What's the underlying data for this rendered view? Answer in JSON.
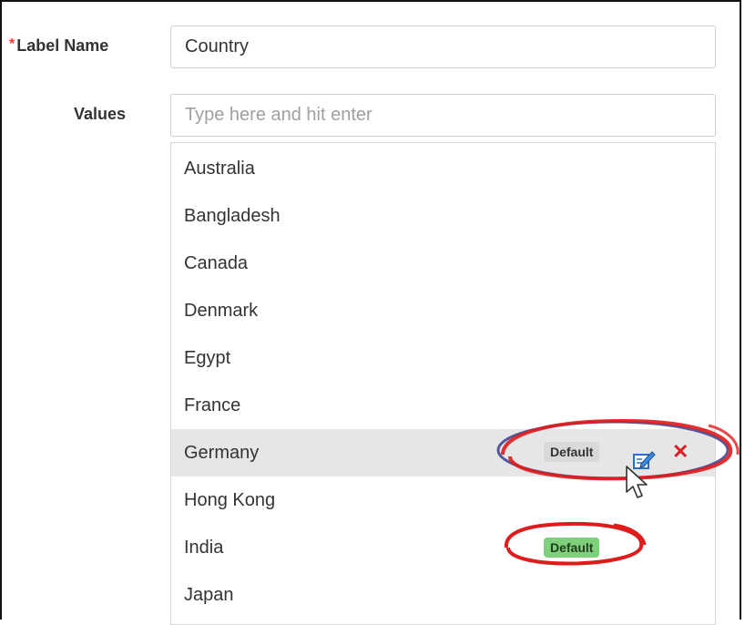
{
  "form": {
    "label_name": {
      "required_marker": "*",
      "label": "Label Name",
      "value": "Country"
    },
    "values": {
      "label": "Values",
      "placeholder": "Type here and hit enter"
    }
  },
  "list": {
    "items": [
      {
        "label": "Australia"
      },
      {
        "label": "Bangladesh"
      },
      {
        "label": "Canada"
      },
      {
        "label": "Denmark"
      },
      {
        "label": "Egypt"
      },
      {
        "label": "France"
      },
      {
        "label": "Germany",
        "hovered": true,
        "badge": "Default",
        "actions": [
          "edit-icon",
          "delete-icon"
        ]
      },
      {
        "label": "Hong Kong"
      },
      {
        "label": "India",
        "badge": "Default",
        "badge_color": "#7ed07a"
      },
      {
        "label": "Japan"
      }
    ],
    "delete_glyph": "✕"
  },
  "colors": {
    "required": "#e8402a",
    "hover_row": "#e6e6e6",
    "default_badge_gray": "#d9d9d9",
    "default_badge_green": "#7ed07a",
    "delete": "#d81f26",
    "annotation_red": "#e01b1b"
  }
}
